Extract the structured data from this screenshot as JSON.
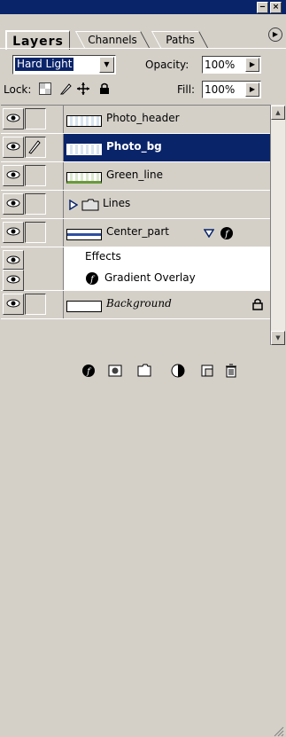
{
  "window": {
    "minimize": "‒",
    "close": "×"
  },
  "tabs": [
    {
      "label": "Layers"
    },
    {
      "label": "Channels"
    },
    {
      "label": "Paths"
    }
  ],
  "menu_icon": "triangle-menu-icon",
  "blend_mode": "Hard Light",
  "opacity": {
    "label": "Opacity:",
    "value": "100%"
  },
  "lock": {
    "label": "Lock:"
  },
  "fill": {
    "label": "Fill:",
    "value": "100%"
  },
  "layers": [
    {
      "name": "Photo_header",
      "thumb": "checker"
    },
    {
      "name": "Photo_bg",
      "thumb": "checker",
      "selected": true
    },
    {
      "name": "Green_line",
      "thumb": "green"
    },
    {
      "name": "Lines",
      "thumb": "folder"
    },
    {
      "name": "Center_part",
      "thumb": "blue"
    },
    {
      "name": "Effects"
    },
    {
      "name": "Gradient Overlay"
    },
    {
      "name": "Background",
      "thumb": "white"
    }
  ],
  "colors": {
    "selection": "#0a246a",
    "panel": "#d4d0c8"
  }
}
